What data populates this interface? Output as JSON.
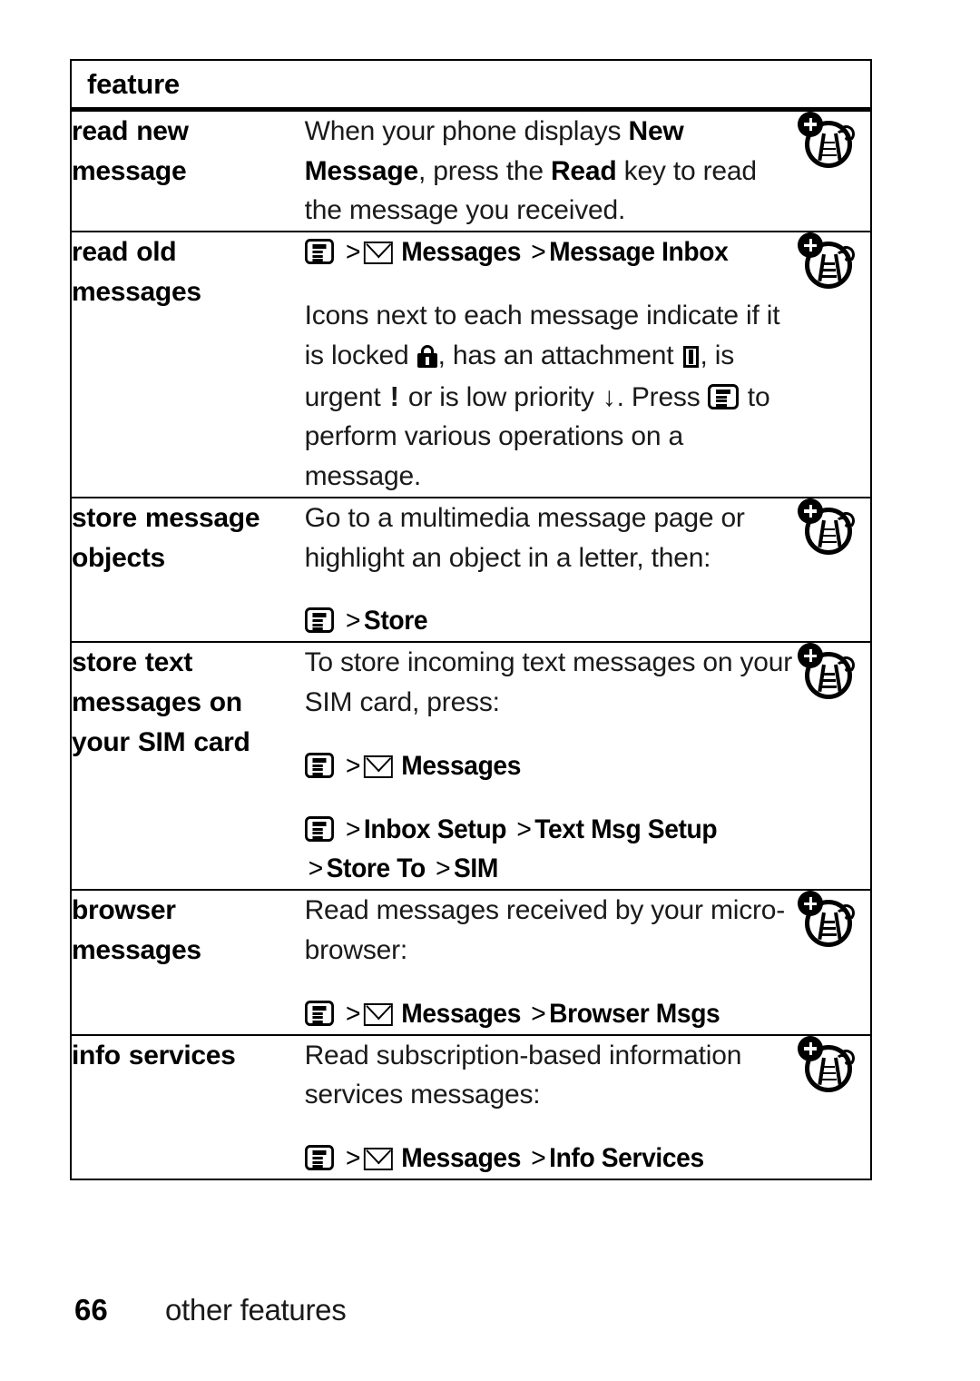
{
  "page": {
    "number": "66",
    "section_title": "other features"
  },
  "table": {
    "header": {
      "feature_column": "feature"
    },
    "rows": [
      {
        "feature": "read new message",
        "feature_lines": [
          "read new",
          "message"
        ],
        "description_blocks": [
          {
            "type": "text",
            "runs": [
              {
                "text": "When your phone displays ",
                "bold": false
              },
              {
                "text": "New Message",
                "bold": true
              },
              {
                "text": ", press the ",
                "bold": false
              },
              {
                "text": "Read",
                "bold": true
              },
              {
                "text": " key to read the message you received.",
                "bold": false
              }
            ]
          }
        ],
        "icon": "network-tower-plus-icon"
      },
      {
        "feature": "read old messages",
        "feature_lines": [
          "read old",
          "messages"
        ],
        "description_blocks": [
          {
            "type": "path",
            "items": [
              {
                "kind": "icon",
                "name": "menu-key-icon"
              },
              {
                "kind": "arrow",
                "text": ">"
              },
              {
                "kind": "icon",
                "name": "envelope-icon"
              },
              {
                "kind": "label",
                "text": "Messages"
              },
              {
                "kind": "arrow",
                "text": ">"
              },
              {
                "kind": "label",
                "text": "Message Inbox"
              }
            ]
          },
          {
            "type": "text",
            "runs": [
              {
                "text": "Icons next to each message indicate if it is locked ",
                "bold": false
              },
              {
                "kind": "icon",
                "name": "padlock-icon"
              },
              {
                "text": ", has an attachment ",
                "bold": false
              },
              {
                "kind": "icon",
                "name": "attachment-icon"
              },
              {
                "text": ", is urgent ",
                "bold": false
              },
              {
                "kind": "glyph",
                "text": "!",
                "name": "urgent-glyph"
              },
              {
                "text": " or is low priority ",
                "bold": false
              },
              {
                "kind": "glyph",
                "text": "↓",
                "name": "low-priority-glyph"
              },
              {
                "text": ". Press ",
                "bold": false
              },
              {
                "kind": "icon",
                "name": "menu-key-icon"
              },
              {
                "text": " to perform various operations on a message.",
                "bold": false
              }
            ]
          }
        ],
        "icon": "network-tower-plus-icon"
      },
      {
        "feature": "store message objects",
        "feature_lines": [
          "store message",
          "objects"
        ],
        "description_blocks": [
          {
            "type": "text",
            "runs": [
              {
                "text": "Go to a multimedia message page or highlight an object in a letter, then:",
                "bold": false
              }
            ]
          },
          {
            "type": "path",
            "items": [
              {
                "kind": "icon",
                "name": "menu-key-icon"
              },
              {
                "kind": "arrow",
                "text": ">"
              },
              {
                "kind": "label",
                "text": "Store"
              }
            ]
          }
        ],
        "icon": "network-tower-plus-icon"
      },
      {
        "feature": "store text messages on your SIM card",
        "feature_lines": [
          "store text",
          "messages on",
          "your SIM card"
        ],
        "description_blocks": [
          {
            "type": "text",
            "runs": [
              {
                "text": "To store incoming text messages on your SIM card, press:",
                "bold": false
              }
            ]
          },
          {
            "type": "path",
            "items": [
              {
                "kind": "icon",
                "name": "menu-key-icon"
              },
              {
                "kind": "arrow",
                "text": ">"
              },
              {
                "kind": "icon",
                "name": "envelope-icon"
              },
              {
                "kind": "label",
                "text": "Messages"
              }
            ]
          },
          {
            "type": "path",
            "items": [
              {
                "kind": "icon",
                "name": "menu-key-icon"
              },
              {
                "kind": "arrow",
                "text": ">"
              },
              {
                "kind": "label",
                "text": "Inbox Setup"
              },
              {
                "kind": "arrow",
                "text": ">"
              },
              {
                "kind": "label",
                "text": "Text Msg Setup"
              },
              {
                "kind": "arrow",
                "text": ">"
              },
              {
                "kind": "label",
                "text": "Store To"
              },
              {
                "kind": "arrow",
                "text": ">"
              },
              {
                "kind": "label",
                "text": "SIM"
              }
            ]
          }
        ],
        "icon": "network-tower-plus-icon"
      },
      {
        "feature": "browser messages",
        "feature_lines": [
          "browser",
          "messages"
        ],
        "description_blocks": [
          {
            "type": "text",
            "runs": [
              {
                "text": "Read messages received by your micro-browser:",
                "bold": false
              }
            ]
          },
          {
            "type": "path",
            "items": [
              {
                "kind": "icon",
                "name": "menu-key-icon"
              },
              {
                "kind": "arrow",
                "text": ">"
              },
              {
                "kind": "icon",
                "name": "envelope-icon"
              },
              {
                "kind": "label",
                "text": "Messages"
              },
              {
                "kind": "arrow",
                "text": ">"
              },
              {
                "kind": "label",
                "text": "Browser Msgs"
              }
            ]
          }
        ],
        "icon": "network-tower-plus-icon"
      },
      {
        "feature": "info services",
        "feature_lines": [
          "info services"
        ],
        "description_blocks": [
          {
            "type": "text",
            "runs": [
              {
                "text": "Read subscription-based information services messages:",
                "bold": false
              }
            ]
          },
          {
            "type": "path",
            "items": [
              {
                "kind": "icon",
                "name": "menu-key-icon"
              },
              {
                "kind": "arrow",
                "text": ">"
              },
              {
                "kind": "icon",
                "name": "envelope-icon"
              },
              {
                "kind": "label",
                "text": "Messages"
              },
              {
                "kind": "arrow",
                "text": ">"
              },
              {
                "kind": "label",
                "text": "Info Services"
              }
            ]
          }
        ],
        "icon": "network-tower-plus-icon"
      }
    ]
  },
  "colors": {
    "ink": "#000000",
    "body_text": "#1a1a1a",
    "paper": "#ffffff"
  }
}
